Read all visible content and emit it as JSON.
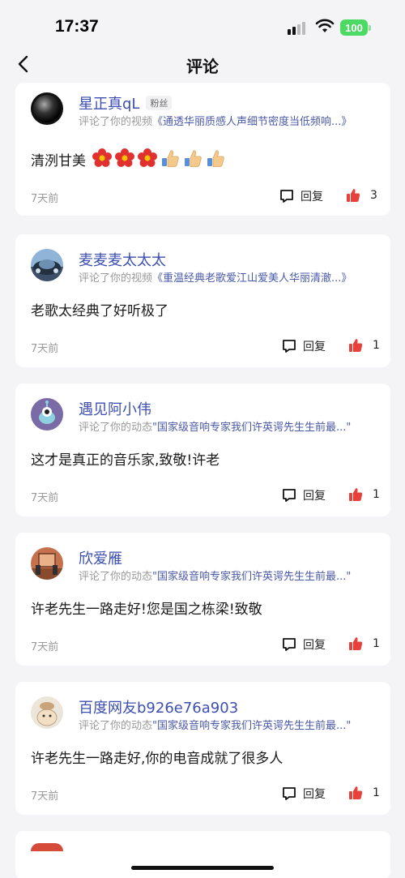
{
  "status": {
    "time": "17:37",
    "battery": "100"
  },
  "header": {
    "title": "评论"
  },
  "labels": {
    "reply": "回复"
  },
  "comments": [
    {
      "user": "星正真qL",
      "badge": "粉丝",
      "action": "评论了你的视频",
      "work": "《通透华丽质感人声细节密度当低频响...》",
      "text": "清洌甘美",
      "emojis": [
        "flower",
        "flower",
        "flower",
        "thumbs-up",
        "thumbs-up",
        "thumbs-up"
      ],
      "time": "7天前",
      "likes": "3",
      "avatar": "dark-sphere"
    },
    {
      "user": "麦麦麦太太太",
      "action": "评论了你的视频",
      "work": "《重温经典老歌爱江山爱美人华丽清澈...》",
      "text": "老歌太经典了好听极了",
      "time": "7天前",
      "likes": "1",
      "avatar": "car"
    },
    {
      "user": "遇见阿小伟",
      "action": "评论了你的动态",
      "work": "\"国家级音响专家我们许英谔先生生前最...\"",
      "text": "这才是真正的音乐家,致敬!许老",
      "time": "7天前",
      "likes": "1",
      "avatar": "alien"
    },
    {
      "user": "欣爱雁",
      "action": "评论了你的动态",
      "work": "\"国家级音响专家我们许英谔先生生前最...\"",
      "text": "许老先生一路走好!您是国之栋梁!致敬",
      "time": "7天前",
      "likes": "1",
      "avatar": "painting"
    },
    {
      "user": "百度网友b926e76a903",
      "action": "评论了你的动态",
      "work": "\"国家级音响专家我们许英谔先生生前最...\"",
      "text": "许老先生一路走好,你的电音成就了很多人",
      "time": "7天前",
      "likes": "1",
      "avatar": "cartoon"
    }
  ]
}
